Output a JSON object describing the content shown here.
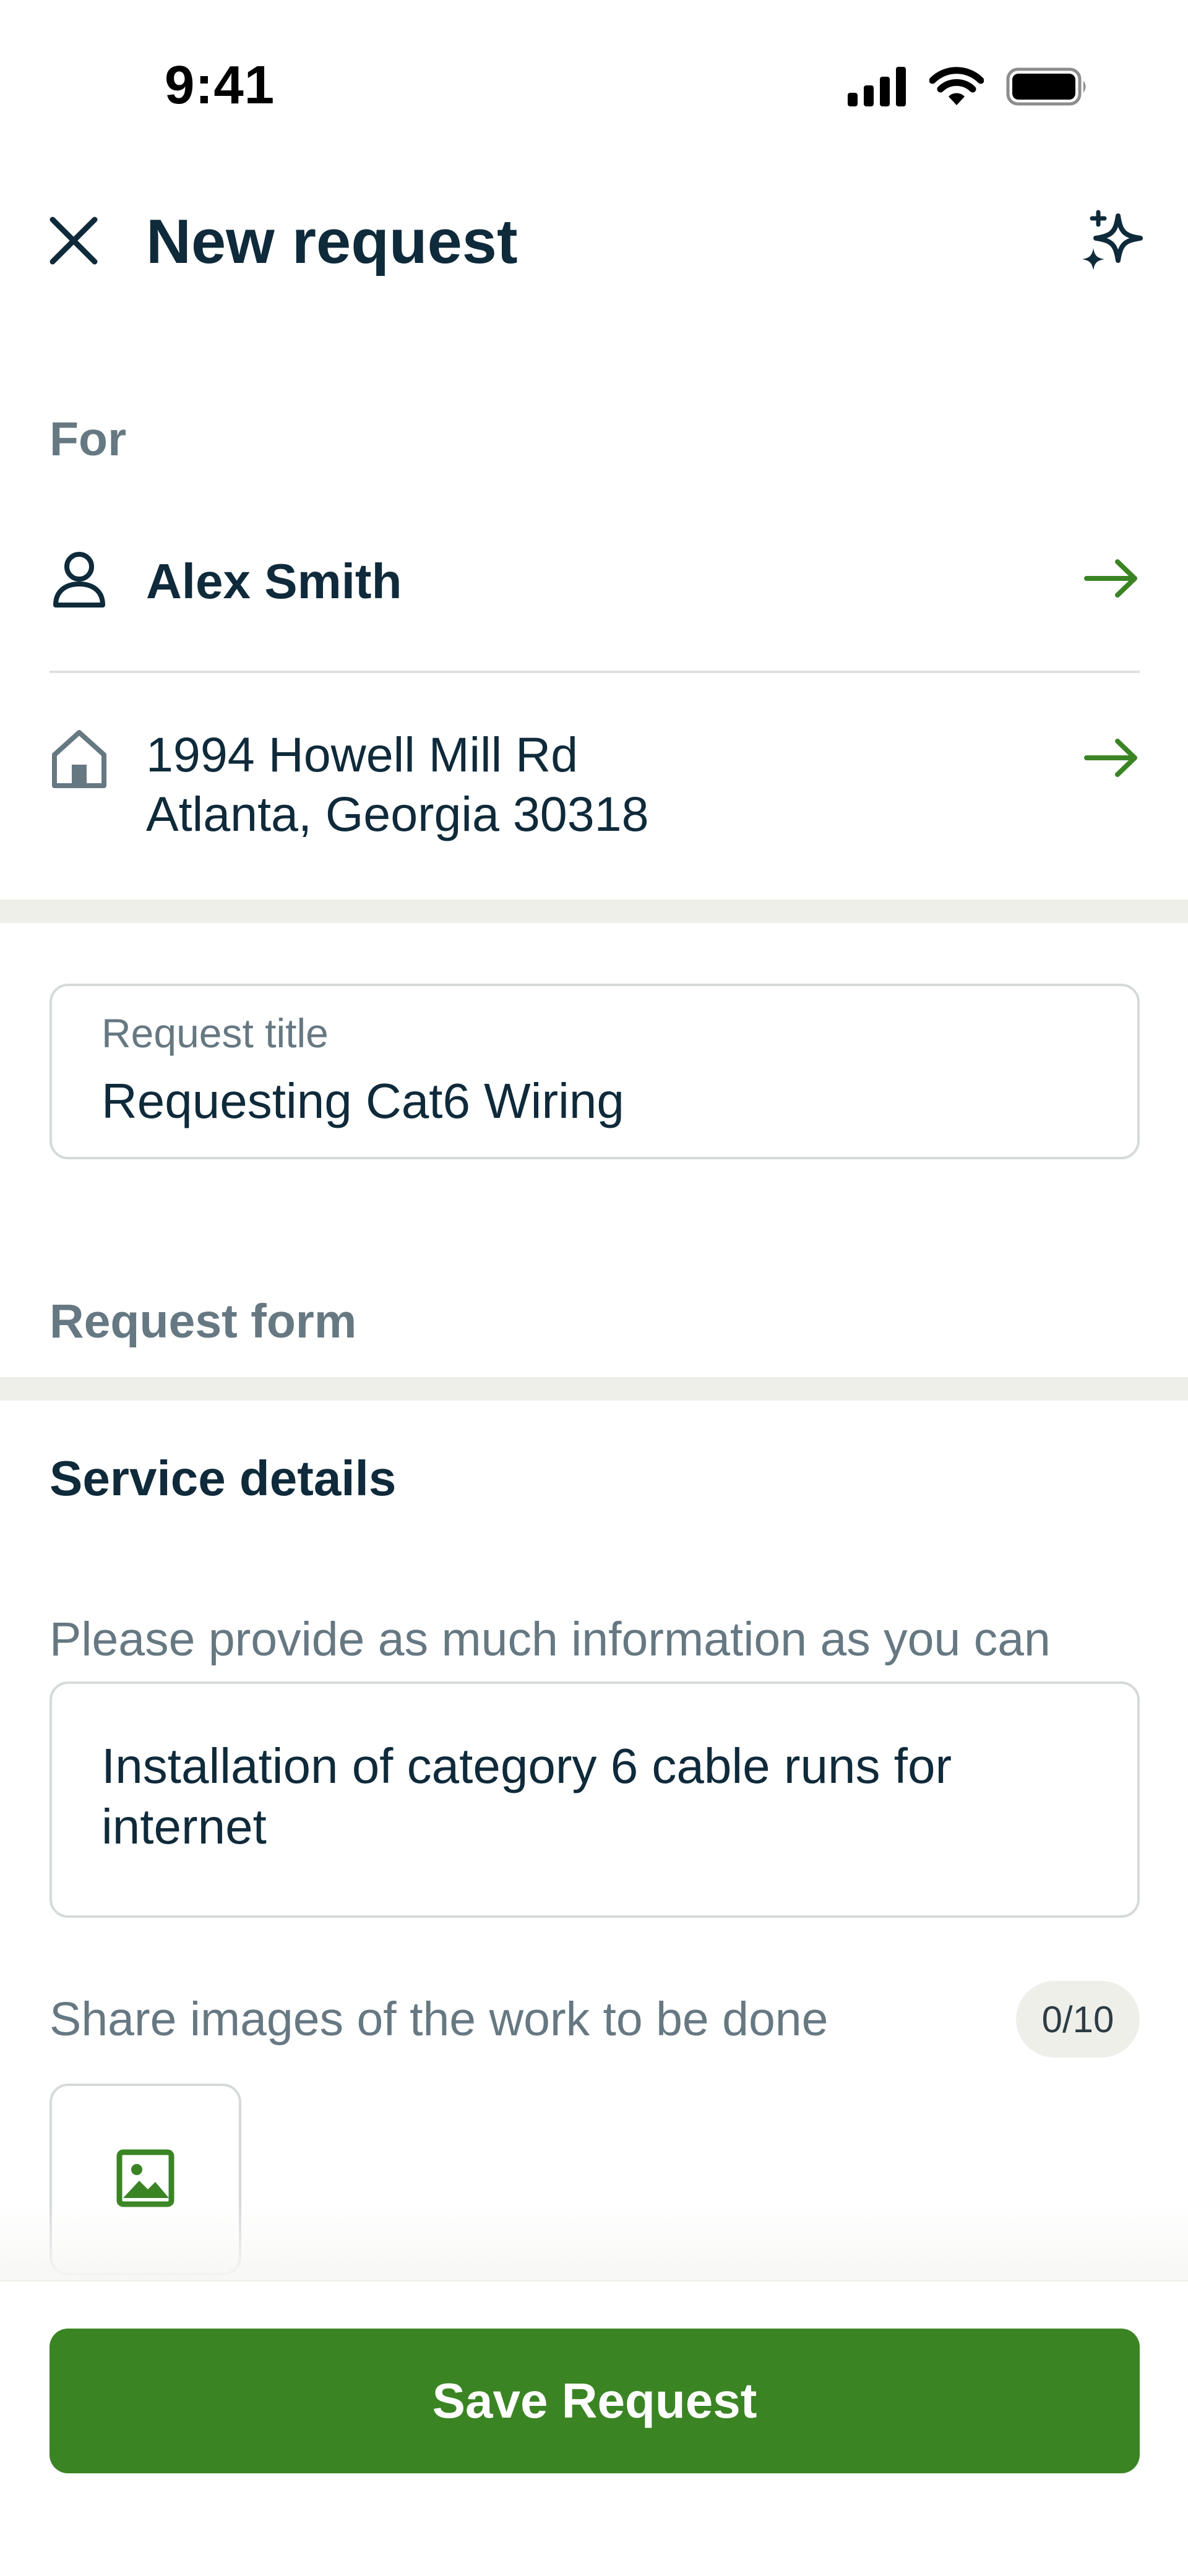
{
  "status_bar": {
    "time": "9:41",
    "icons": [
      "signal-icon",
      "wifi-icon",
      "battery-icon"
    ]
  },
  "header": {
    "title": "New request",
    "close_icon": "close-icon",
    "ai_icon": "sparkle-icon"
  },
  "for_section": {
    "label": "For",
    "person": {
      "icon": "person-icon",
      "name": "Alex Smith"
    },
    "address": {
      "icon": "home-icon",
      "line1": "1994 Howell Mill Rd",
      "line2": "Atlanta, Georgia 30318"
    }
  },
  "request_title": {
    "label": "Request title",
    "value": "Requesting Cat6 Wiring"
  },
  "request_form": {
    "label": "Request form"
  },
  "service_details": {
    "title": "Service details",
    "description_help": "Please provide as much information as you can",
    "description_value": "Installation of category 6 cable runs for internet",
    "images_help": "Share images of the work to be done",
    "images_count": "0/10",
    "add_image_icon": "image-icon"
  },
  "footer": {
    "save_label": "Save Request"
  },
  "colors": {
    "accent": "#3a8424",
    "text": "#0f2a3a",
    "muted": "#667882",
    "band": "#efefea"
  }
}
